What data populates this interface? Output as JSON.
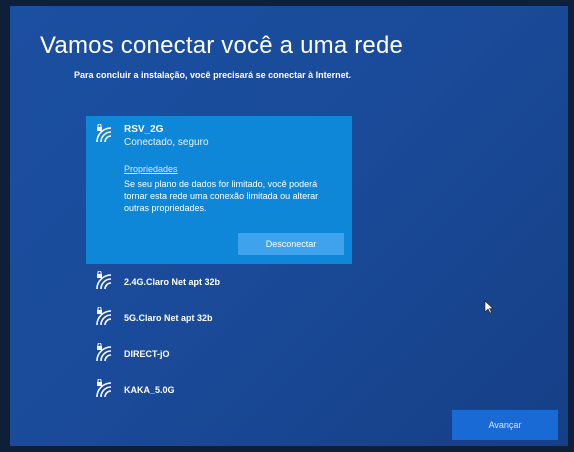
{
  "header": {
    "title": "Vamos conectar você a uma rede",
    "subtitle": "Para concluir a instalação, você precisará se conectar à Internet."
  },
  "networks": {
    "connected": {
      "name": "RSV_2G",
      "status": "Conectado, seguro",
      "properties_link": "Propriedades",
      "properties_desc": "Se seu plano de dados for limitado, você poderá tornar esta rede uma conexão limitada ou alterar outras propriedades.",
      "disconnect_label": "Desconectar"
    },
    "items": [
      {
        "name": "2.4G.Claro Net apt 32b"
      },
      {
        "name": "5G.Claro Net apt 32b"
      },
      {
        "name": "DIRECT-jO"
      },
      {
        "name": "KAKA_5.0G"
      }
    ]
  },
  "footer": {
    "advance_label": "Avançar"
  },
  "colors": {
    "background": "#1b4fa0",
    "selected": "#0f87d8",
    "button": "#1a6ad6"
  },
  "icons": {
    "network": "wifi-secured-icon",
    "pointer": "mouse-cursor-icon"
  }
}
